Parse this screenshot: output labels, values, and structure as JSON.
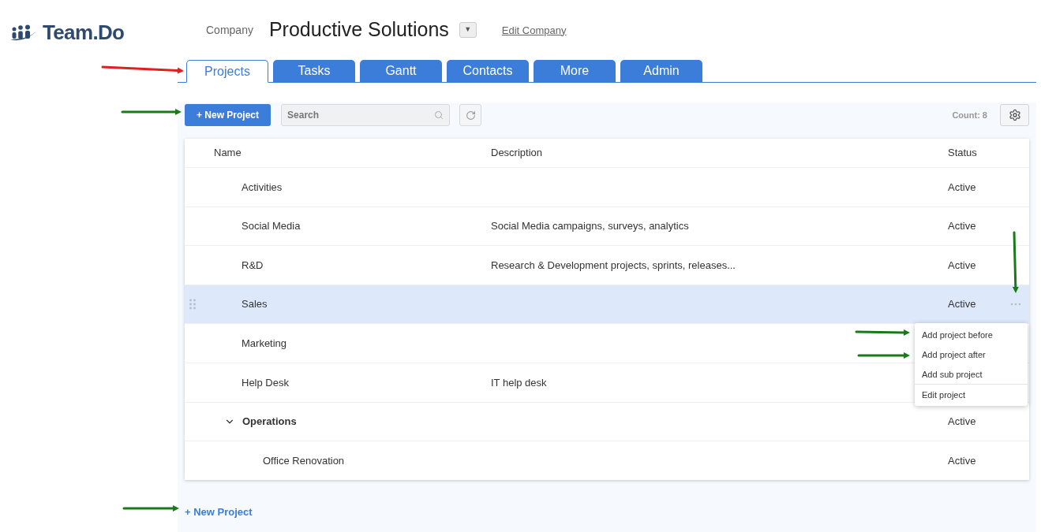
{
  "brand": {
    "name": "Team.Do"
  },
  "company": {
    "label": "Company",
    "name": "Productive Solutions",
    "dropdown": "▼",
    "edit_link": "Edit Company"
  },
  "tabs": [
    {
      "label": "Projects",
      "selected": true
    },
    {
      "label": "Tasks",
      "selected": false
    },
    {
      "label": "Gantt",
      "selected": false
    },
    {
      "label": "Contacts",
      "selected": false
    },
    {
      "label": "More",
      "selected": false
    },
    {
      "label": "Admin",
      "selected": false
    }
  ],
  "toolbar": {
    "new_button": "+ New Project",
    "search": {
      "placeholder": "Search"
    },
    "count": "Count: 8"
  },
  "table": {
    "columns": [
      "Name",
      "Description",
      "Status"
    ],
    "rows": [
      {
        "name": "Activities",
        "status": "Active",
        "selected": false
      },
      {
        "name": "Social Media",
        "description": "Social Media campaigns, surveys, analytics",
        "status": "Active",
        "selected": false
      },
      {
        "name": "R&D",
        "description": "Research & Development projects, sprints, releases...",
        "status": "Active",
        "selected": false
      },
      {
        "name": "Sales",
        "status": "Active",
        "selected": true
      },
      {
        "name": "Marketing",
        "selected": false
      },
      {
        "name": "Help Desk",
        "description": "IT help desk",
        "selected": false
      },
      {
        "name": "Operations",
        "status": "Active",
        "selected": false,
        "expanded": true,
        "children": [
          {
            "name": "Office Renovation",
            "status": "Active",
            "selected": false
          }
        ]
      }
    ]
  },
  "context_menu": {
    "items": [
      "Add project before",
      "Add project after",
      "Add sub project"
    ],
    "footer_items": [
      "Edit project"
    ]
  },
  "footer_link": "+ New Project",
  "annotations": [
    {
      "kind": "arrow",
      "color": "#e02020"
    },
    {
      "kind": "arrow",
      "color": "#1a7a1a"
    },
    {
      "kind": "arrow",
      "color": "#1a7a1a"
    },
    {
      "kind": "arrow",
      "color": "#1a7a1a"
    },
    {
      "kind": "arrow",
      "color": "#1a7a1a"
    },
    {
      "kind": "arrow",
      "color": "#1a7a1a"
    }
  ]
}
